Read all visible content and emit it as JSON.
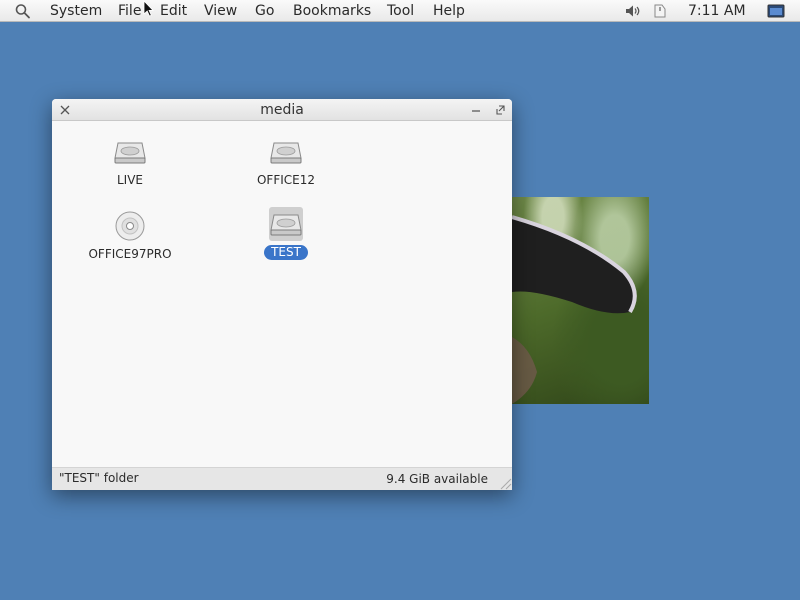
{
  "menubar": {
    "items": [
      "System",
      "File",
      "Edit",
      "View",
      "Go",
      "Bookmarks",
      "Tool",
      "Help"
    ],
    "clock": "7:11 AM",
    "tray_icons": [
      "volume-icon",
      "power-icon",
      "display-icon"
    ]
  },
  "window": {
    "title": "media",
    "items": [
      {
        "label": "LIVE",
        "icon": "hard-drive-icon",
        "selected": false
      },
      {
        "label": "OFFICE12",
        "icon": "hard-drive-icon",
        "selected": false
      },
      {
        "label": "OFFICE97PRO",
        "icon": "optical-disc-icon",
        "selected": false
      },
      {
        "label": "TEST",
        "icon": "hard-drive-icon",
        "selected": true
      }
    ],
    "status": {
      "selection": "\"TEST\" folder",
      "free_space": "9.4 GiB available"
    }
  },
  "colors": {
    "desktop": "#4f80b5",
    "selection": "#3a75c9"
  }
}
